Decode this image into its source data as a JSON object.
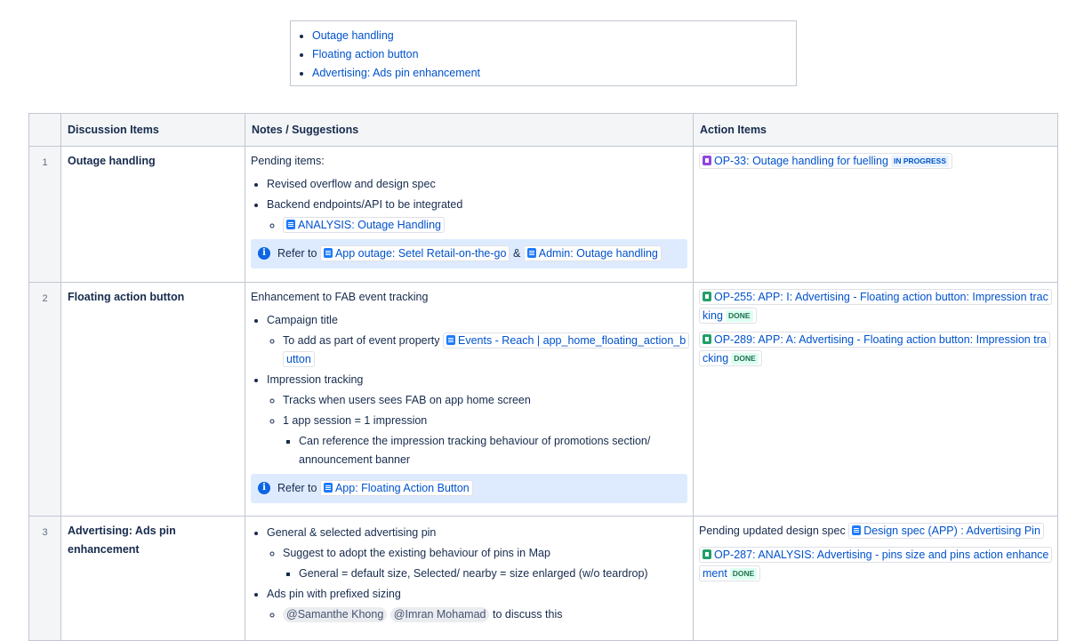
{
  "toc": {
    "items": [
      "Outage handling",
      "Floating action button",
      "Advertising: Ads pin enhancement"
    ]
  },
  "table": {
    "headers": {
      "num": "",
      "discussion": "Discussion Items",
      "notes": "Notes / Suggestions",
      "actions": "Action Items"
    },
    "rows": [
      {
        "num": "1",
        "discussion": "Outage handling",
        "notes": {
          "intro": "Pending items:",
          "b1": "Revised overflow and design spec",
          "b2": "Backend endpoints/API to be integrated",
          "b2_link": "ANALYSIS: Outage Handling",
          "panel_refer": "Refer to",
          "panel_link1": "App outage: Setel Retail-on-the-go",
          "panel_amp": "&",
          "panel_link2": "Admin: Outage handling"
        },
        "actions": {
          "a1_key": "OP-33: Outage handling for fuelling",
          "a1_status": "IN PROGRESS"
        }
      },
      {
        "num": "2",
        "discussion": "Floating action button",
        "notes": {
          "intro": "Enhancement to FAB event tracking",
          "b1": "Campaign title",
          "b1_sub": "To add as part of event property",
          "b1_sub_link": "Events - Reach | app_home_floating_action_button",
          "b2": "Impression tracking",
          "b2_sub1": "Tracks when users sees FAB on app home screen",
          "b2_sub2": "1 app session = 1 impression",
          "b2_sub2_sub": "Can reference the impression tracking behaviour of promotions section/ announcement banner",
          "panel_refer": "Refer to",
          "panel_link1": "App: Floating Action Button"
        },
        "actions": {
          "a1_key": "OP-255: APP: I: Advertising - Floating action button: Impression tracking",
          "a1_status": "DONE",
          "a2_key": "OP-289: APP: A: Advertising - Floating action button: Impression tracking",
          "a2_status": "DONE"
        }
      },
      {
        "num": "3",
        "discussion": "Advertising: Ads pin enhancement",
        "notes": {
          "b1": "General & selected advertising pin",
          "b1_sub": "Suggest to adopt the existing behaviour of pins in Map",
          "b1_sub_sub": "General = default size, Selected/ nearby = size enlarged (w/o teardrop)",
          "b2": "Ads pin with prefixed sizing",
          "b2_mention1": "@Samanthe Khong",
          "b2_mention2": "@Imran Mohamad",
          "b2_tail": "to discuss this"
        },
        "actions": {
          "pending": "Pending updated design spec",
          "pending_link": "Design spec (APP) : Advertising Pin",
          "a1_key": "OP-287: ANALYSIS: Advertising - pins size and pins action enhancement",
          "a1_status": "DONE"
        }
      }
    ]
  },
  "colors": {
    "link": "#0052cc",
    "header_bg": "#f4f5f7",
    "panel_bg": "#deebff",
    "done_lozenge": "#dcfff1",
    "inprogress_lozenge": "#e9f2ff",
    "epic_icon": "#8f46dd",
    "story_icon": "#22a06b",
    "page_icon": "#1d7afc"
  }
}
